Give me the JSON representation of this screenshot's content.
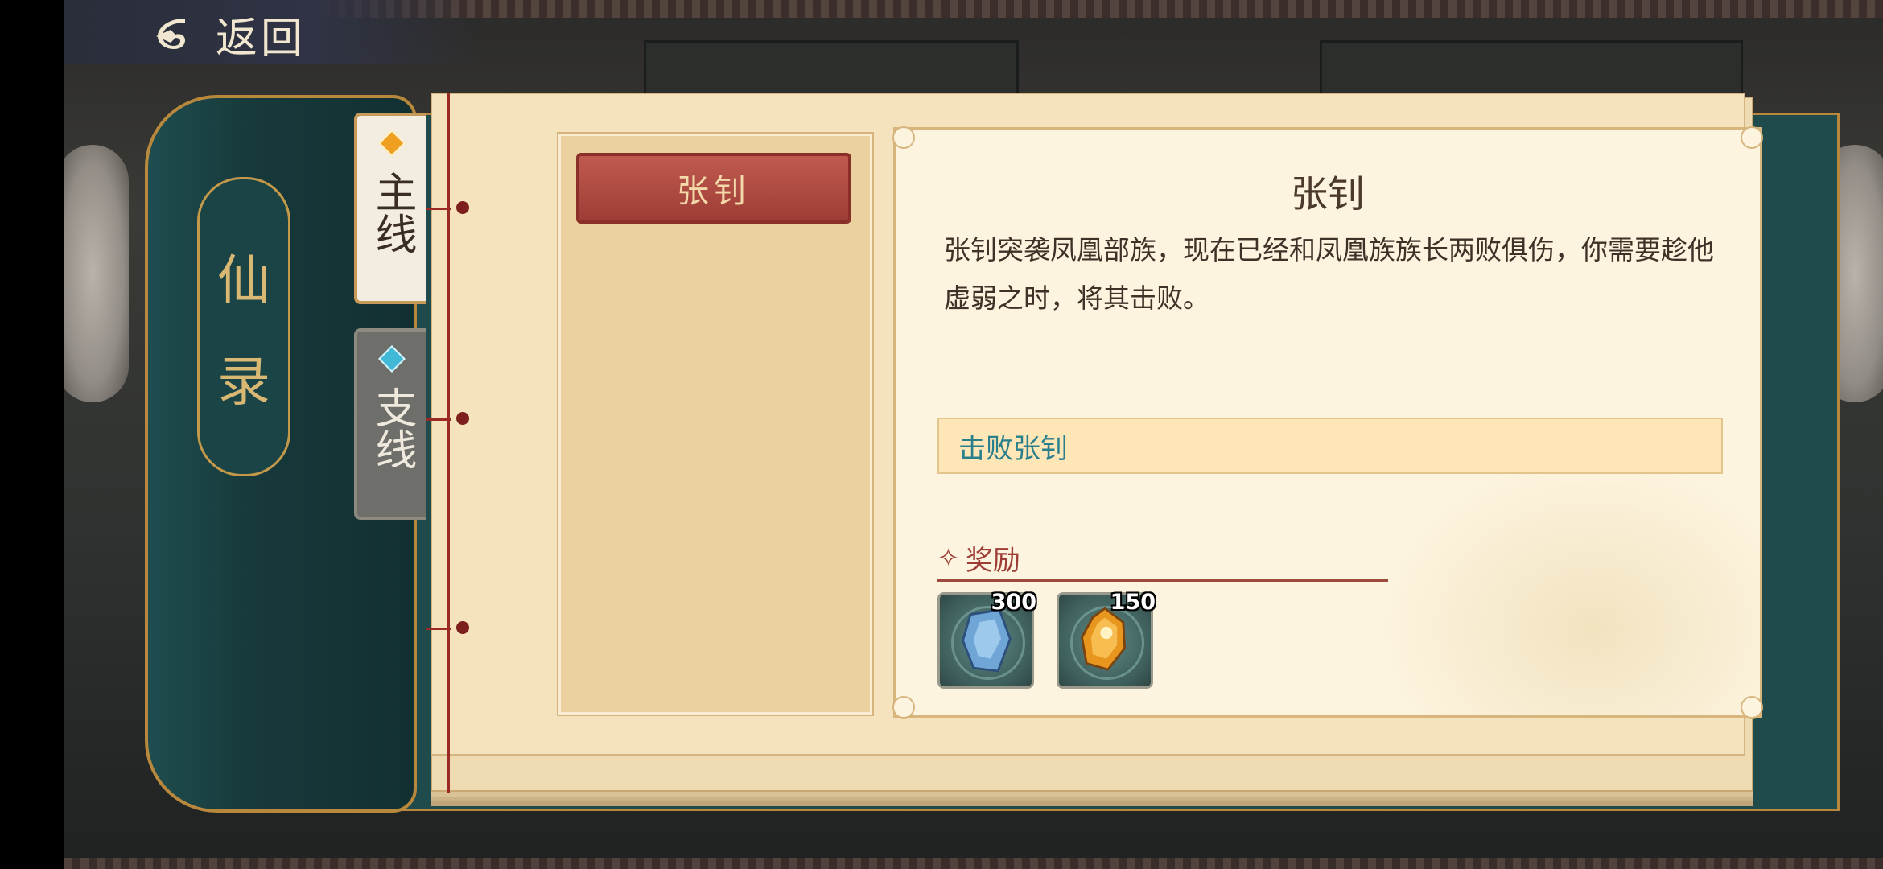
{
  "header": {
    "back_label": "返回"
  },
  "book": {
    "spine_title": [
      "仙",
      "录"
    ]
  },
  "tabs": [
    {
      "label": "主线",
      "active": true,
      "marker_color": "#f0a020"
    },
    {
      "label": "支线",
      "active": false,
      "marker_color": "#3fb9d6"
    }
  ],
  "quest_list": [
    {
      "label": "张钊",
      "selected": true
    }
  ],
  "detail": {
    "title": "张钊",
    "description": "张钊突袭凤凰部族，现在已经和凤凰族族长两败俱伤，你需要趁他虚弱之时，将其击败。",
    "objective": "击败张钊",
    "reward_label": "奖励",
    "rewards": [
      {
        "icon": "blue-crystal-icon",
        "count": "300"
      },
      {
        "icon": "orange-crystal-icon",
        "count": "150"
      }
    ]
  },
  "colors": {
    "accent_red": "#9d3d36",
    "objective_text": "#2a7f8d",
    "spine_teal": "#1f4d4f"
  }
}
